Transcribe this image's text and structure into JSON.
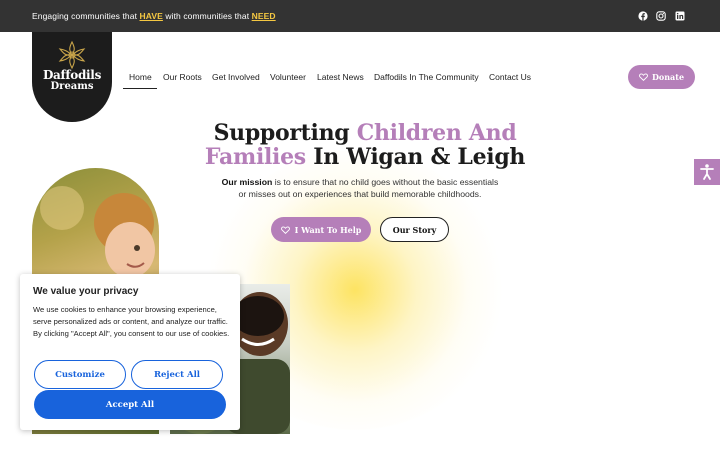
{
  "topbar": {
    "tagline_pre": "Engaging communities that ",
    "tagline_hl1": "HAVE",
    "tagline_mid": " with communities that ",
    "tagline_hl2": "NEED",
    "social_icons": [
      "facebook-icon",
      "instagram-icon",
      "linkedin-icon"
    ]
  },
  "logo": {
    "line1": "Daffodils",
    "line2": "Dreams"
  },
  "nav": {
    "items": [
      "Home",
      "Our Roots",
      "Get Involved",
      "Volunteer",
      "Latest News",
      "Daffodils In The Community",
      "Contact Us"
    ],
    "active": "Home"
  },
  "donate_label": "Donate",
  "hero": {
    "title_dark1": "Supporting ",
    "title_purple1": "Children And",
    "title_purple2": "Families",
    "title_dark2": " In Wigan & Leigh",
    "mission_bold": "Our mission",
    "mission_line1": " is to ensure that no child goes without the basic essentials",
    "mission_line2": "or misses out on experiences that build memorable childhoods.",
    "help_label": "I Want To Help",
    "story_label": "Our Story"
  },
  "cookie": {
    "title": "We value your privacy",
    "body": "We use cookies to enhance your browsing experience, serve personalized ads or content, and analyze our traffic. By clicking \"Accept All\", you consent to our use of cookies.",
    "customize_label": "Customize",
    "reject_label": "Reject All",
    "accept_label": "Accept All"
  },
  "colors": {
    "topbar": "#333333",
    "accent_purple": "#b57fb9",
    "highlight_yellow": "#f5c842",
    "cookie_blue": "#1863dc"
  }
}
